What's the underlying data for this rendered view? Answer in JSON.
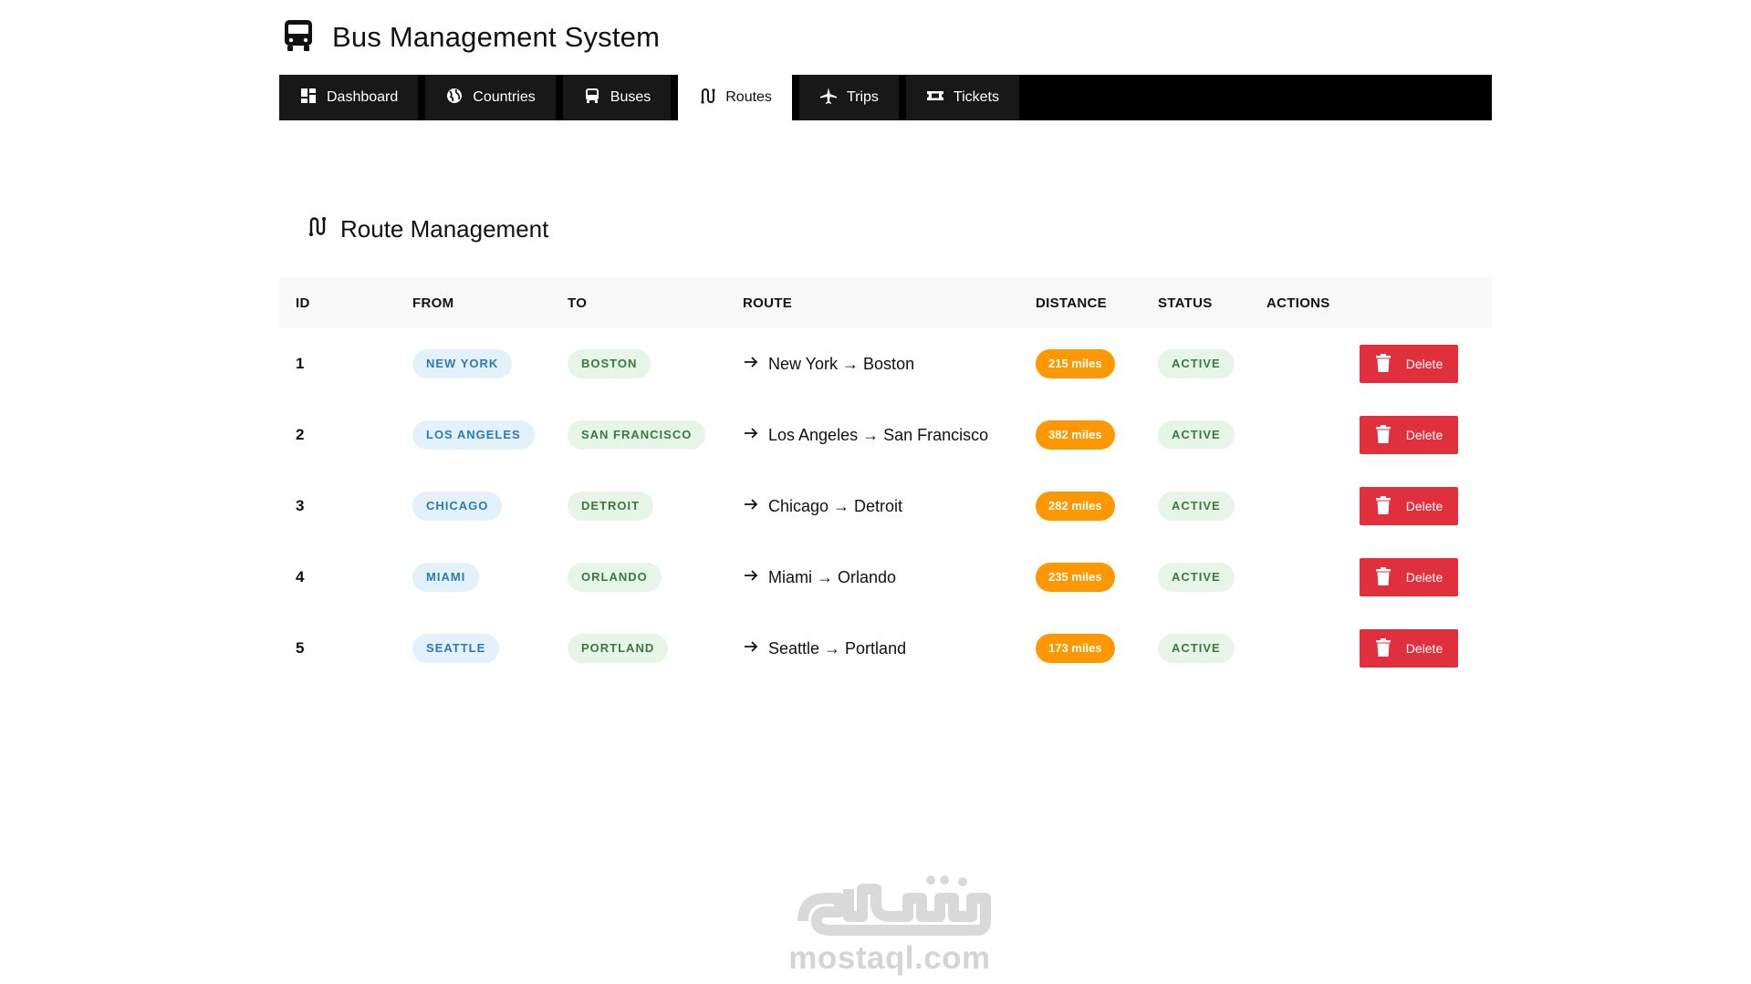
{
  "app": {
    "title": "Bus Management System"
  },
  "nav": [
    {
      "label": "Dashboard",
      "icon": "dashboard-icon",
      "active": false
    },
    {
      "label": "Countries",
      "icon": "globe-icon",
      "active": false
    },
    {
      "label": "Buses",
      "icon": "bus-icon",
      "active": false
    },
    {
      "label": "Routes",
      "icon": "route-icon",
      "active": true
    },
    {
      "label": "Trips",
      "icon": "plane-icon",
      "active": false
    },
    {
      "label": "Tickets",
      "icon": "ticket-icon",
      "active": false
    }
  ],
  "section": {
    "title": "Route Management"
  },
  "table": {
    "headers": {
      "id": "ID",
      "from": "FROM",
      "to": "TO",
      "route": "ROUTE",
      "distance": "DISTANCE",
      "status": "STATUS",
      "actions": "ACTIONS"
    },
    "rows": [
      {
        "id": "1",
        "from": "NEW YORK",
        "to": "BOSTON",
        "route": "New York → Boston",
        "distance": "215 miles",
        "status": "ACTIVE",
        "action": "Delete"
      },
      {
        "id": "2",
        "from": "LOS ANGELES",
        "to": "SAN FRANCISCO",
        "route": "Los Angeles → San Francisco",
        "distance": "382 miles",
        "status": "ACTIVE",
        "action": "Delete"
      },
      {
        "id": "3",
        "from": "CHICAGO",
        "to": "DETROIT",
        "route": "Chicago → Detroit",
        "distance": "282 miles",
        "status": "ACTIVE",
        "action": "Delete"
      },
      {
        "id": "4",
        "from": "MIAMI",
        "to": "ORLANDO",
        "route": "Miami → Orlando",
        "distance": "235 miles",
        "status": "ACTIVE",
        "action": "Delete"
      },
      {
        "id": "5",
        "from": "SEATTLE",
        "to": "PORTLAND",
        "route": "Seattle → Portland",
        "distance": "173 miles",
        "status": "ACTIVE",
        "action": "Delete"
      }
    ]
  },
  "watermark": {
    "text": "mostaql.com"
  },
  "colors": {
    "nav_bg": "#000000",
    "delete": "#e0303e",
    "distance": "#ff9800",
    "from_pill_bg": "#e3f1fb",
    "to_pill_bg": "#e7f4e8"
  }
}
